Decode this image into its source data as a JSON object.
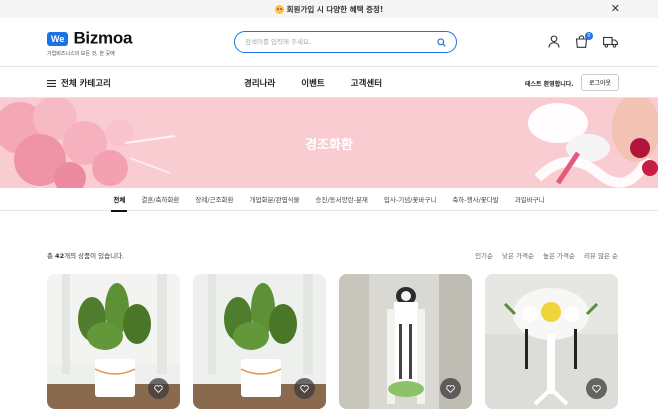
{
  "promo": {
    "text": "회원가입 시 다양한 혜택 증정!",
    "close_icon": "close-icon"
  },
  "logo": {
    "badge": "We",
    "name": "Bizmoa",
    "tagline": "기업비즈니스의 모든 것, 한 곳에"
  },
  "search": {
    "placeholder": "검색어를 입력해 주세요."
  },
  "header_icons": {
    "cart_count": "0"
  },
  "nav": {
    "all_categories": "전체 카테고리",
    "menu": [
      "경리나라",
      "이벤트",
      "고객센터"
    ],
    "welcome": "테스트 환영합니다.",
    "logout": "로그아웃"
  },
  "banner": {
    "title": "경조화환"
  },
  "categories": [
    "전체",
    "결혼/축하화환",
    "장례/근조화환",
    "개업화분/관엽식물",
    "승진/동서양란-분재",
    "입사-기념/꽃바구니",
    "축하-행사/꽃다발",
    "과일바구니"
  ],
  "list": {
    "prefix": "총 ",
    "count": "42",
    "suffix": "개의 상품이 있습니다."
  },
  "sorts": [
    "인기순",
    "낮은 가격순",
    "높은 가격순",
    "리뷰 많은 순"
  ],
  "colors": {
    "accent": "#1a73e8",
    "banner_bg": "#f9ccd2"
  }
}
